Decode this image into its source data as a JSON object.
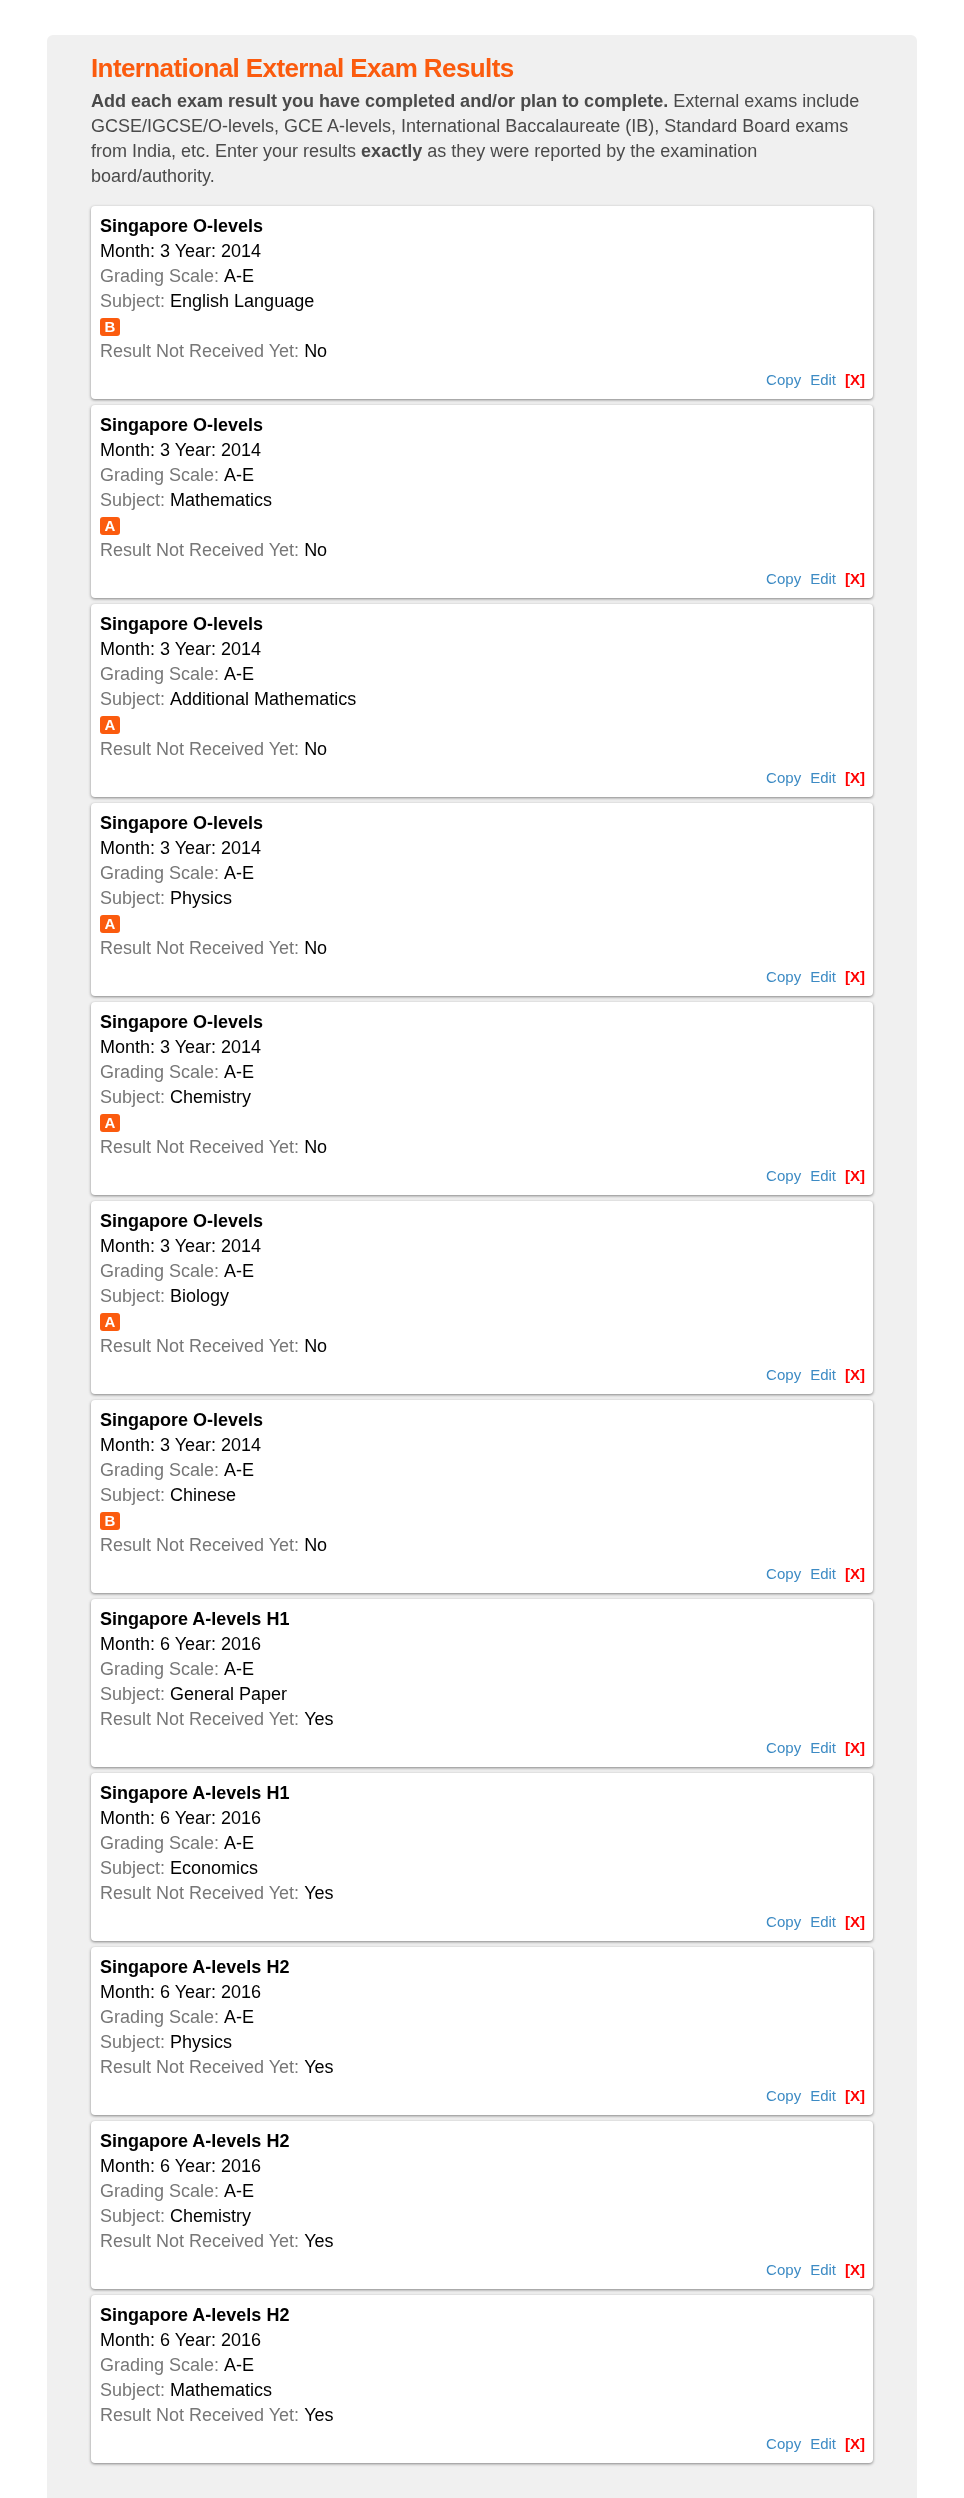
{
  "title": "International External Exam Results",
  "intro": "**Add each exam result you have completed and/or plan to complete.** External exams include GCSE/IGCSE/O-levels, GCE A-levels, International Baccalaureate (IB), Standard Board exams from India, etc. Enter your results **exactly** as they were reported by the examination board/authority.",
  "results": [
    {
      "exam": "Singapore O-levels",
      "date": "Month: 3 Year: 2014",
      "rows": [
        {
          "kind": "field",
          "label": "Grading Scale:",
          "value": "A-E"
        },
        {
          "kind": "field",
          "label": "Subject:",
          "value": "English Language"
        },
        {
          "kind": "grade",
          "value": "B"
        },
        {
          "kind": "field",
          "label": "Result Not Received Yet:",
          "value": "No"
        }
      ],
      "actions": [
        {
          "kind": "copy",
          "label": "Copy"
        },
        {
          "kind": "edit",
          "label": "Edit"
        },
        {
          "kind": "delete",
          "label": "[X]"
        }
      ]
    },
    {
      "exam": "Singapore O-levels",
      "date": "Month: 3 Year: 2014",
      "rows": [
        {
          "kind": "field",
          "label": "Grading Scale:",
          "value": "A-E"
        },
        {
          "kind": "field",
          "label": "Subject:",
          "value": "Mathematics"
        },
        {
          "kind": "grade",
          "value": "A"
        },
        {
          "kind": "field",
          "label": "Result Not Received Yet:",
          "value": "No"
        }
      ],
      "actions": [
        {
          "kind": "copy",
          "label": "Copy"
        },
        {
          "kind": "edit",
          "label": "Edit"
        },
        {
          "kind": "delete",
          "label": "[X]"
        }
      ]
    },
    {
      "exam": "Singapore O-levels",
      "date": "Month: 3 Year: 2014",
      "rows": [
        {
          "kind": "field",
          "label": "Grading Scale:",
          "value": "A-E"
        },
        {
          "kind": "field",
          "label": "Subject:",
          "value": "Additional Mathematics"
        },
        {
          "kind": "grade",
          "value": "A"
        },
        {
          "kind": "field",
          "label": "Result Not Received Yet:",
          "value": "No"
        }
      ],
      "actions": [
        {
          "kind": "copy",
          "label": "Copy"
        },
        {
          "kind": "edit",
          "label": "Edit"
        },
        {
          "kind": "delete",
          "label": "[X]"
        }
      ]
    },
    {
      "exam": "Singapore O-levels",
      "date": "Month: 3 Year: 2014",
      "rows": [
        {
          "kind": "field",
          "label": "Grading Scale:",
          "value": "A-E"
        },
        {
          "kind": "field",
          "label": "Subject:",
          "value": "Physics"
        },
        {
          "kind": "grade",
          "value": "A"
        },
        {
          "kind": "field",
          "label": "Result Not Received Yet:",
          "value": "No"
        }
      ],
      "actions": [
        {
          "kind": "copy",
          "label": "Copy"
        },
        {
          "kind": "edit",
          "label": "Edit"
        },
        {
          "kind": "delete",
          "label": "[X]"
        }
      ]
    },
    {
      "exam": "Singapore O-levels",
      "date": "Month: 3 Year: 2014",
      "rows": [
        {
          "kind": "field",
          "label": "Grading Scale:",
          "value": "A-E"
        },
        {
          "kind": "field",
          "label": "Subject:",
          "value": "Chemistry"
        },
        {
          "kind": "grade",
          "value": "A"
        },
        {
          "kind": "field",
          "label": "Result Not Received Yet:",
          "value": "No"
        }
      ],
      "actions": [
        {
          "kind": "copy",
          "label": "Copy"
        },
        {
          "kind": "edit",
          "label": "Edit"
        },
        {
          "kind": "delete",
          "label": "[X]"
        }
      ]
    },
    {
      "exam": "Singapore O-levels",
      "date": "Month: 3 Year: 2014",
      "rows": [
        {
          "kind": "field",
          "label": "Grading Scale:",
          "value": "A-E"
        },
        {
          "kind": "field",
          "label": "Subject:",
          "value": "Biology"
        },
        {
          "kind": "grade",
          "value": "A"
        },
        {
          "kind": "field",
          "label": "Result Not Received Yet:",
          "value": "No"
        }
      ],
      "actions": [
        {
          "kind": "copy",
          "label": "Copy"
        },
        {
          "kind": "edit",
          "label": "Edit"
        },
        {
          "kind": "delete",
          "label": "[X]"
        }
      ]
    },
    {
      "exam": "Singapore O-levels",
      "date": "Month: 3 Year: 2014",
      "rows": [
        {
          "kind": "field",
          "label": "Grading Scale:",
          "value": "A-E"
        },
        {
          "kind": "field",
          "label": "Subject:",
          "value": "Chinese"
        },
        {
          "kind": "grade",
          "value": "B"
        },
        {
          "kind": "field",
          "label": "Result Not Received Yet:",
          "value": "No"
        }
      ],
      "actions": [
        {
          "kind": "copy",
          "label": "Copy"
        },
        {
          "kind": "edit",
          "label": "Edit"
        },
        {
          "kind": "delete",
          "label": "[X]"
        }
      ]
    },
    {
      "exam": "Singapore A-levels H1",
      "date": "Month: 6 Year: 2016",
      "rows": [
        {
          "kind": "field",
          "label": "Grading Scale:",
          "value": "A-E"
        },
        {
          "kind": "field",
          "label": "Subject:",
          "value": "General Paper"
        },
        {
          "kind": "field",
          "label": "Result Not Received Yet:",
          "value": "Yes"
        }
      ],
      "actions": [
        {
          "kind": "copy",
          "label": "Copy"
        },
        {
          "kind": "edit",
          "label": "Edit"
        },
        {
          "kind": "delete",
          "label": "[X]"
        }
      ]
    },
    {
      "exam": "Singapore A-levels H1",
      "date": "Month: 6 Year: 2016",
      "rows": [
        {
          "kind": "field",
          "label": "Grading Scale:",
          "value": "A-E"
        },
        {
          "kind": "field",
          "label": "Subject:",
          "value": "Economics"
        },
        {
          "kind": "field",
          "label": "Result Not Received Yet:",
          "value": "Yes"
        }
      ],
      "actions": [
        {
          "kind": "copy",
          "label": "Copy"
        },
        {
          "kind": "edit",
          "label": "Edit"
        },
        {
          "kind": "delete",
          "label": "[X]"
        }
      ]
    },
    {
      "exam": "Singapore A-levels H2",
      "date": "Month: 6 Year: 2016",
      "rows": [
        {
          "kind": "field",
          "label": "Grading Scale:",
          "value": "A-E"
        },
        {
          "kind": "field",
          "label": "Subject:",
          "value": "Physics"
        },
        {
          "kind": "field",
          "label": "Result Not Received Yet:",
          "value": "Yes"
        }
      ],
      "actions": [
        {
          "kind": "copy",
          "label": "Copy"
        },
        {
          "kind": "edit",
          "label": "Edit"
        },
        {
          "kind": "delete",
          "label": "[X]"
        }
      ]
    },
    {
      "exam": "Singapore A-levels H2",
      "date": "Month: 6 Year: 2016",
      "rows": [
        {
          "kind": "field",
          "label": "Grading Scale:",
          "value": "A-E"
        },
        {
          "kind": "field",
          "label": "Subject:",
          "value": "Chemistry"
        },
        {
          "kind": "field",
          "label": "Result Not Received Yet:",
          "value": "Yes"
        }
      ],
      "actions": [
        {
          "kind": "copy",
          "label": "Copy"
        },
        {
          "kind": "edit",
          "label": "Edit"
        },
        {
          "kind": "delete",
          "label": "[X]"
        }
      ]
    },
    {
      "exam": "Singapore A-levels H2",
      "date": "Month: 6 Year: 2016",
      "rows": [
        {
          "kind": "field",
          "label": "Grading Scale:",
          "value": "A-E"
        },
        {
          "kind": "field",
          "label": "Subject:",
          "value": "Mathematics"
        },
        {
          "kind": "field",
          "label": "Result Not Received Yet:",
          "value": "Yes"
        }
      ],
      "actions": [
        {
          "kind": "copy",
          "label": "Copy"
        },
        {
          "kind": "edit",
          "label": "Edit"
        },
        {
          "kind": "delete",
          "label": "[X]"
        }
      ]
    }
  ]
}
